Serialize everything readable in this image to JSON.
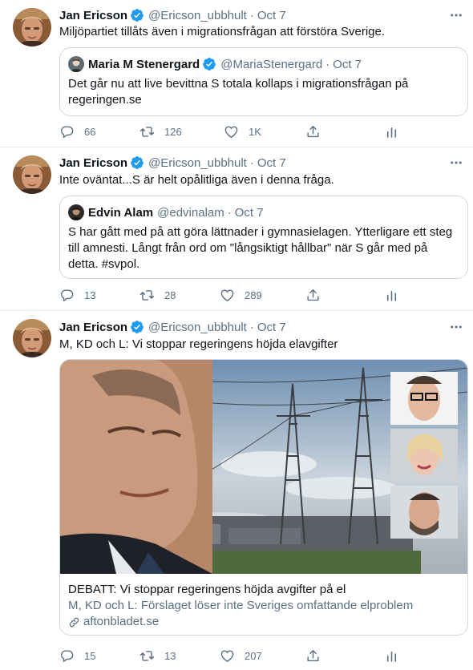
{
  "colors": {
    "verified": "#1d9bf0",
    "secondary_text": "#5b7083",
    "border": "#cfd9de",
    "divider": "#e6ecf0"
  },
  "icons": [
    "verified-badge-icon",
    "more-icon",
    "reply-icon",
    "retweet-icon",
    "like-icon",
    "share-icon",
    "analytics-icon",
    "link-icon"
  ],
  "tweets": [
    {
      "author": {
        "name": "Jan Ericson",
        "handle": "@Ericson_ubbhult",
        "verified": true
      },
      "dot": "·",
      "time": "Oct 7",
      "text": "Miljöpartiet tillåts även i migrationsfrågan att förstöra Sverige.",
      "quote": {
        "author": {
          "name": "Maria M Stenergard",
          "handle": "@MariaStenergard",
          "verified": true
        },
        "time": "Oct 7",
        "text": "Det går nu att live bevittna S totala kollaps i migrationsfrågan på regeringen.se"
      },
      "stats": {
        "replies": "66",
        "retweets": "126",
        "likes": "1K"
      }
    },
    {
      "author": {
        "name": "Jan Ericson",
        "handle": "@Ericson_ubbhult",
        "verified": true
      },
      "dot": "·",
      "time": "Oct 7",
      "text": "Inte oväntat...S är helt opålitliga även i denna fråga.",
      "quote": {
        "author": {
          "name": "Edvin Alam",
          "handle": "@edvinalam",
          "verified": false
        },
        "time": "Oct 7",
        "text": "S har gått med på att göra lättnader i gymnasielagen. Ytterligare ett steg till amnesti. Långt från ord om \"långsiktigt hållbar\" när S går med på detta. #svpol."
      },
      "stats": {
        "replies": "13",
        "retweets": "28",
        "likes": "289"
      }
    },
    {
      "author": {
        "name": "Jan Ericson",
        "handle": "@Ericson_ubbhult",
        "verified": true
      },
      "dot": "·",
      "time": "Oct 7",
      "text": "M, KD och L: Vi stoppar regeringens höjda elavgifter",
      "card": {
        "title": "DEBATT: Vi stoppar regeringens höjda avgifter på el",
        "description": "M, KD och L: Förslaget löser inte Sveriges omfattande elproblem",
        "domain": "aftonbladet.se"
      },
      "stats": {
        "replies": "15",
        "retweets": "13",
        "likes": "207"
      }
    }
  ]
}
